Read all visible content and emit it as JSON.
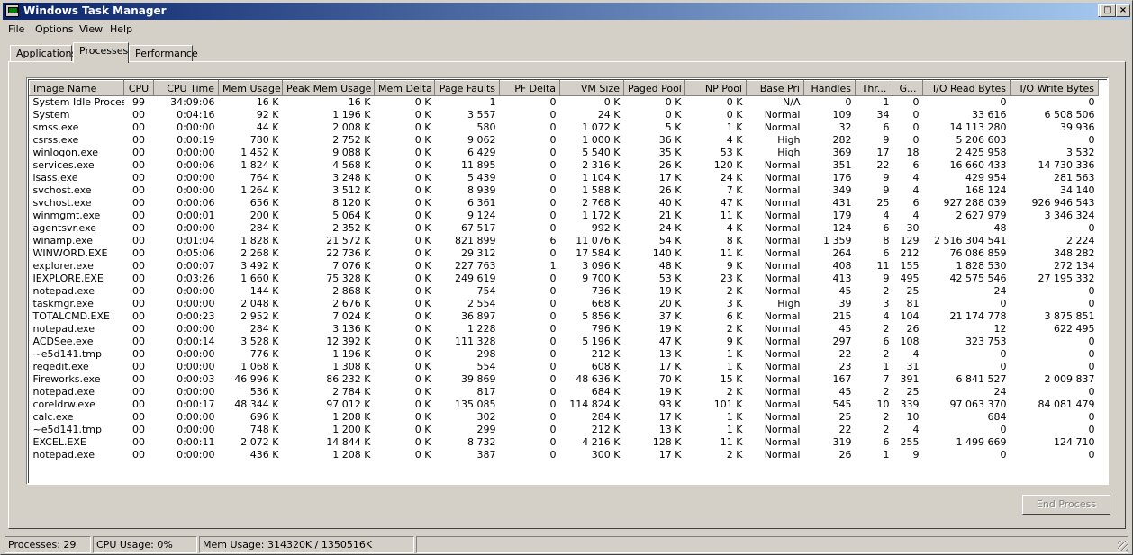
{
  "window": {
    "title": "Windows Task Manager"
  },
  "menu": [
    "File",
    "Options",
    "View",
    "Help"
  ],
  "tabs": [
    "Applications",
    "Processes",
    "Performance"
  ],
  "active_tab": "Processes",
  "columns": [
    "Image Name",
    "CPU",
    "CPU Time",
    "Mem Usage",
    "Peak Mem Usage",
    "Mem Delta",
    "Page Faults",
    "PF Delta",
    "VM Size",
    "Paged Pool",
    "NP Pool",
    "Base Pri",
    "Handles",
    "Thr...",
    "G...",
    "I/O Read Bytes",
    "I/O Write Bytes"
  ],
  "rows": [
    [
      "System Idle Process",
      "99",
      "34:09:06",
      "16 K",
      "16 K",
      "0 K",
      "1",
      "0",
      "0 K",
      "0 K",
      "0 K",
      "N/A",
      "0",
      "1",
      "0",
      "0",
      "0"
    ],
    [
      "System",
      "00",
      "0:04:16",
      "92 K",
      "1 196 K",
      "0 K",
      "3 557",
      "0",
      "24 K",
      "0 K",
      "0 K",
      "Normal",
      "109",
      "34",
      "0",
      "33 616",
      "6 508 506"
    ],
    [
      "smss.exe",
      "00",
      "0:00:00",
      "44 K",
      "2 008 K",
      "0 K",
      "580",
      "0",
      "1 072 K",
      "5 K",
      "1 K",
      "Normal",
      "32",
      "6",
      "0",
      "14 113 280",
      "39 936"
    ],
    [
      "csrss.exe",
      "00",
      "0:00:19",
      "780 K",
      "2 752 K",
      "0 K",
      "9 062",
      "0",
      "1 000 K",
      "36 K",
      "4 K",
      "High",
      "282",
      "9",
      "0",
      "5 206 603",
      "0"
    ],
    [
      "winlogon.exe",
      "00",
      "0:00:00",
      "1 452 K",
      "9 088 K",
      "0 K",
      "6 429",
      "0",
      "5 540 K",
      "35 K",
      "53 K",
      "High",
      "369",
      "17",
      "18",
      "2 425 958",
      "3 532"
    ],
    [
      "services.exe",
      "00",
      "0:00:06",
      "1 824 K",
      "4 568 K",
      "0 K",
      "11 895",
      "0",
      "2 316 K",
      "26 K",
      "120 K",
      "Normal",
      "351",
      "22",
      "6",
      "16 660 433",
      "14 730 336"
    ],
    [
      "lsass.exe",
      "00",
      "0:00:00",
      "764 K",
      "3 248 K",
      "0 K",
      "5 439",
      "0",
      "1 104 K",
      "17 K",
      "24 K",
      "Normal",
      "176",
      "9",
      "4",
      "429 954",
      "281 563"
    ],
    [
      "svchost.exe",
      "00",
      "0:00:00",
      "1 264 K",
      "3 512 K",
      "0 K",
      "8 939",
      "0",
      "1 588 K",
      "26 K",
      "7 K",
      "Normal",
      "349",
      "9",
      "4",
      "168 124",
      "34 140"
    ],
    [
      "svchost.exe",
      "00",
      "0:00:06",
      "656 K",
      "8 120 K",
      "0 K",
      "6 361",
      "0",
      "2 768 K",
      "40 K",
      "47 K",
      "Normal",
      "431",
      "25",
      "6",
      "927 288 039",
      "926 946 543"
    ],
    [
      "winmgmt.exe",
      "00",
      "0:00:01",
      "200 K",
      "5 064 K",
      "0 K",
      "9 124",
      "0",
      "1 172 K",
      "21 K",
      "11 K",
      "Normal",
      "179",
      "4",
      "4",
      "2 627 979",
      "3 346 324"
    ],
    [
      "agentsvr.exe",
      "00",
      "0:00:00",
      "284 K",
      "2 352 K",
      "0 K",
      "67 517",
      "0",
      "992 K",
      "24 K",
      "4 K",
      "Normal",
      "124",
      "6",
      "30",
      "48",
      "0"
    ],
    [
      "winamp.exe",
      "00",
      "0:01:04",
      "1 828 K",
      "21 572 K",
      "0 K",
      "821 899",
      "6",
      "11 076 K",
      "54 K",
      "8 K",
      "Normal",
      "1 359",
      "8",
      "129",
      "2 516 304 541",
      "2 224"
    ],
    [
      "WINWORD.EXE",
      "00",
      "0:05:06",
      "2 268 K",
      "22 736 K",
      "0 K",
      "29 312",
      "0",
      "17 584 K",
      "140 K",
      "11 K",
      "Normal",
      "264",
      "6",
      "212",
      "76 086 859",
      "348 282"
    ],
    [
      "explorer.exe",
      "00",
      "0:00:07",
      "3 492 K",
      "7 076 K",
      "0 K",
      "227 763",
      "1",
      "3 096 K",
      "48 K",
      "9 K",
      "Normal",
      "408",
      "11",
      "155",
      "1 828 530",
      "272 134"
    ],
    [
      "IEXPLORE.EXE",
      "00",
      "0:03:26",
      "1 660 K",
      "75 328 K",
      "0 K",
      "249 619",
      "0",
      "9 700 K",
      "53 K",
      "23 K",
      "Normal",
      "413",
      "9",
      "495",
      "42 575 546",
      "27 195 332"
    ],
    [
      "notepad.exe",
      "00",
      "0:00:00",
      "144 K",
      "2 868 K",
      "0 K",
      "754",
      "0",
      "736 K",
      "19 K",
      "2 K",
      "Normal",
      "45",
      "2",
      "25",
      "24",
      "0"
    ],
    [
      "taskmgr.exe",
      "00",
      "0:00:00",
      "2 048 K",
      "2 676 K",
      "0 K",
      "2 554",
      "0",
      "668 K",
      "20 K",
      "3 K",
      "High",
      "39",
      "3",
      "81",
      "0",
      "0"
    ],
    [
      "TOTALCMD.EXE",
      "00",
      "0:00:23",
      "2 952 K",
      "7 024 K",
      "0 K",
      "36 897",
      "0",
      "5 856 K",
      "37 K",
      "6 K",
      "Normal",
      "215",
      "4",
      "104",
      "21 174 778",
      "3 875 851"
    ],
    [
      "notepad.exe",
      "00",
      "0:00:00",
      "284 K",
      "3 136 K",
      "0 K",
      "1 228",
      "0",
      "796 K",
      "19 K",
      "2 K",
      "Normal",
      "45",
      "2",
      "26",
      "12",
      "622 495"
    ],
    [
      "ACDSee.exe",
      "00",
      "0:00:14",
      "3 528 K",
      "12 392 K",
      "0 K",
      "111 328",
      "0",
      "5 196 K",
      "47 K",
      "9 K",
      "Normal",
      "297",
      "6",
      "108",
      "323 753",
      "0"
    ],
    [
      "~e5d141.tmp",
      "00",
      "0:00:00",
      "776 K",
      "1 196 K",
      "0 K",
      "298",
      "0",
      "212 K",
      "13 K",
      "1 K",
      "Normal",
      "22",
      "2",
      "4",
      "0",
      "0"
    ],
    [
      "regedit.exe",
      "00",
      "0:00:00",
      "1 068 K",
      "1 308 K",
      "0 K",
      "554",
      "0",
      "608 K",
      "17 K",
      "1 K",
      "Normal",
      "23",
      "1",
      "31",
      "0",
      "0"
    ],
    [
      "Fireworks.exe",
      "00",
      "0:00:03",
      "46 996 K",
      "86 232 K",
      "0 K",
      "39 869",
      "0",
      "48 636 K",
      "70 K",
      "15 K",
      "Normal",
      "167",
      "7",
      "391",
      "6 841 527",
      "2 009 837"
    ],
    [
      "notepad.exe",
      "00",
      "0:00:00",
      "536 K",
      "2 784 K",
      "0 K",
      "817",
      "0",
      "684 K",
      "19 K",
      "2 K",
      "Normal",
      "45",
      "2",
      "25",
      "24",
      "0"
    ],
    [
      "coreldrw.exe",
      "00",
      "0:00:17",
      "48 344 K",
      "97 012 K",
      "0 K",
      "135 085",
      "0",
      "114 824 K",
      "93 K",
      "101 K",
      "Normal",
      "545",
      "10",
      "339",
      "97 063 370",
      "84 081 479"
    ],
    [
      "calc.exe",
      "00",
      "0:00:00",
      "696 K",
      "1 208 K",
      "0 K",
      "302",
      "0",
      "284 K",
      "17 K",
      "1 K",
      "Normal",
      "25",
      "2",
      "10",
      "684",
      "0"
    ],
    [
      "~e5d141.tmp",
      "00",
      "0:00:00",
      "748 K",
      "1 200 K",
      "0 K",
      "299",
      "0",
      "212 K",
      "13 K",
      "1 K",
      "Normal",
      "22",
      "2",
      "4",
      "0",
      "0"
    ],
    [
      "EXCEL.EXE",
      "00",
      "0:00:11",
      "2 072 K",
      "14 844 K",
      "0 K",
      "8 732",
      "0",
      "4 216 K",
      "128 K",
      "11 K",
      "Normal",
      "319",
      "6",
      "255",
      "1 499 669",
      "124 710"
    ],
    [
      "notepad.exe",
      "00",
      "0:00:00",
      "436 K",
      "1 208 K",
      "0 K",
      "387",
      "0",
      "300 K",
      "17 K",
      "2 K",
      "Normal",
      "26",
      "1",
      "9",
      "0",
      "0"
    ]
  ],
  "end_process_label": "End Process",
  "status": {
    "processes": "Processes: 29",
    "cpu": "CPU Usage: 0%",
    "mem": "Mem Usage: 314320K / 1350516K"
  }
}
